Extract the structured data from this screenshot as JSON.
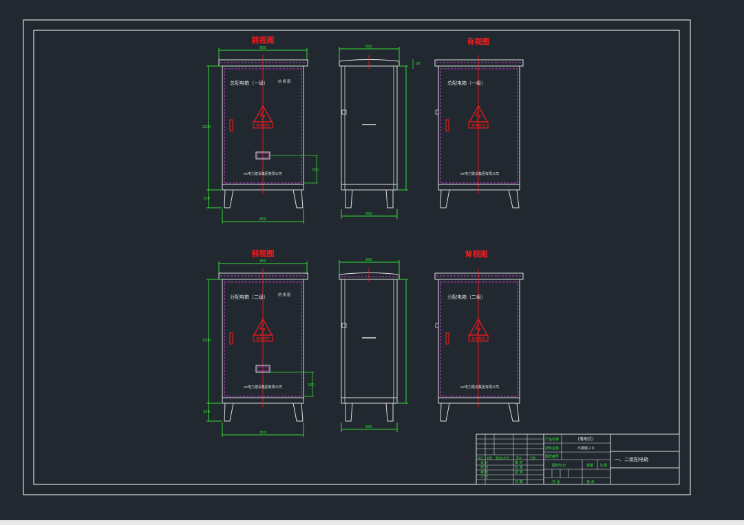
{
  "colors": {
    "background": "#212830",
    "frame": "#ffffff",
    "dimension": "#33dd33",
    "centerline": "#ff2020",
    "hidden": "#ff44ff",
    "label_red": "#ff1a1a"
  },
  "views": {
    "front_title": "前视图",
    "back_title": "背视图"
  },
  "cabinet_top": {
    "name": "总配电箱（一级）",
    "company": "xx电力建设集团有限公司",
    "small_label": "前 视 图",
    "warning_text": "有电危险"
  },
  "cabinet_bottom": {
    "name": "分配电箱（二级）",
    "company": "xx电力建设集团有限公司",
    "small_label": "前 视 图",
    "warning_text": "有电危险"
  },
  "dims": {
    "width": "800",
    "height": "1200",
    "leg": "300",
    "depth": "600",
    "handle": "150",
    "top": "50"
  },
  "title_block": {
    "product_label": "产品名称",
    "product_value": "(落地式)",
    "material_label": "材料名称",
    "material_value": "不锈钢 2 0",
    "drawing_no_label": "图样编号",
    "drawing_title": "一、二级配电箱",
    "rev_headers": [
      "标记",
      "处数",
      "更改文件号",
      "签字",
      "日期"
    ],
    "sign_rows": [
      "设 计",
      "校 对",
      "审 核",
      "工 艺"
    ],
    "sign_right": [
      "审 定",
      "标 准",
      "批 准",
      "日 期"
    ],
    "stage_label": "图样标记",
    "weight_label": "重量",
    "scale_label": "比例",
    "sheet_label": "共  张",
    "sheet_no_label": "第  张"
  }
}
